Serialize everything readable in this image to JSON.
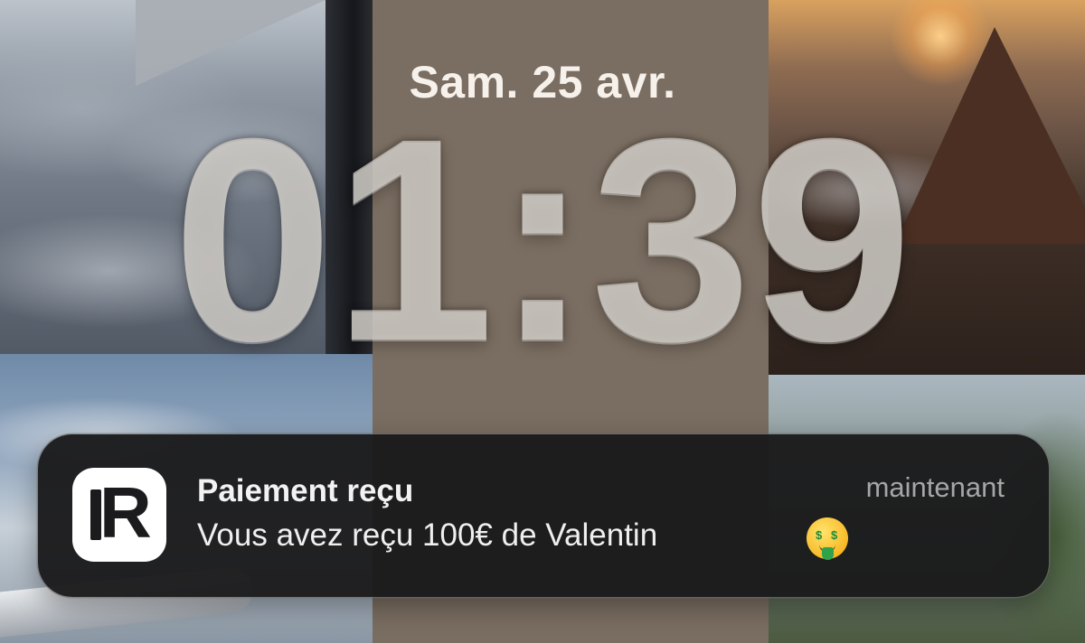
{
  "lock_screen": {
    "date": "Sam. 25 avr.",
    "time": "01:39"
  },
  "notification": {
    "app_icon": "revolut-r-icon",
    "title": "Paiement reçu",
    "body": "Vous avez reçu 100€ de Valentin",
    "timestamp": "maintenant",
    "emoji": "money-mouth-face-icon"
  },
  "colors": {
    "center_band": "#7a6d61",
    "notification_bg": "#1a1a1b",
    "clock_glass": "#d6d1cb"
  }
}
